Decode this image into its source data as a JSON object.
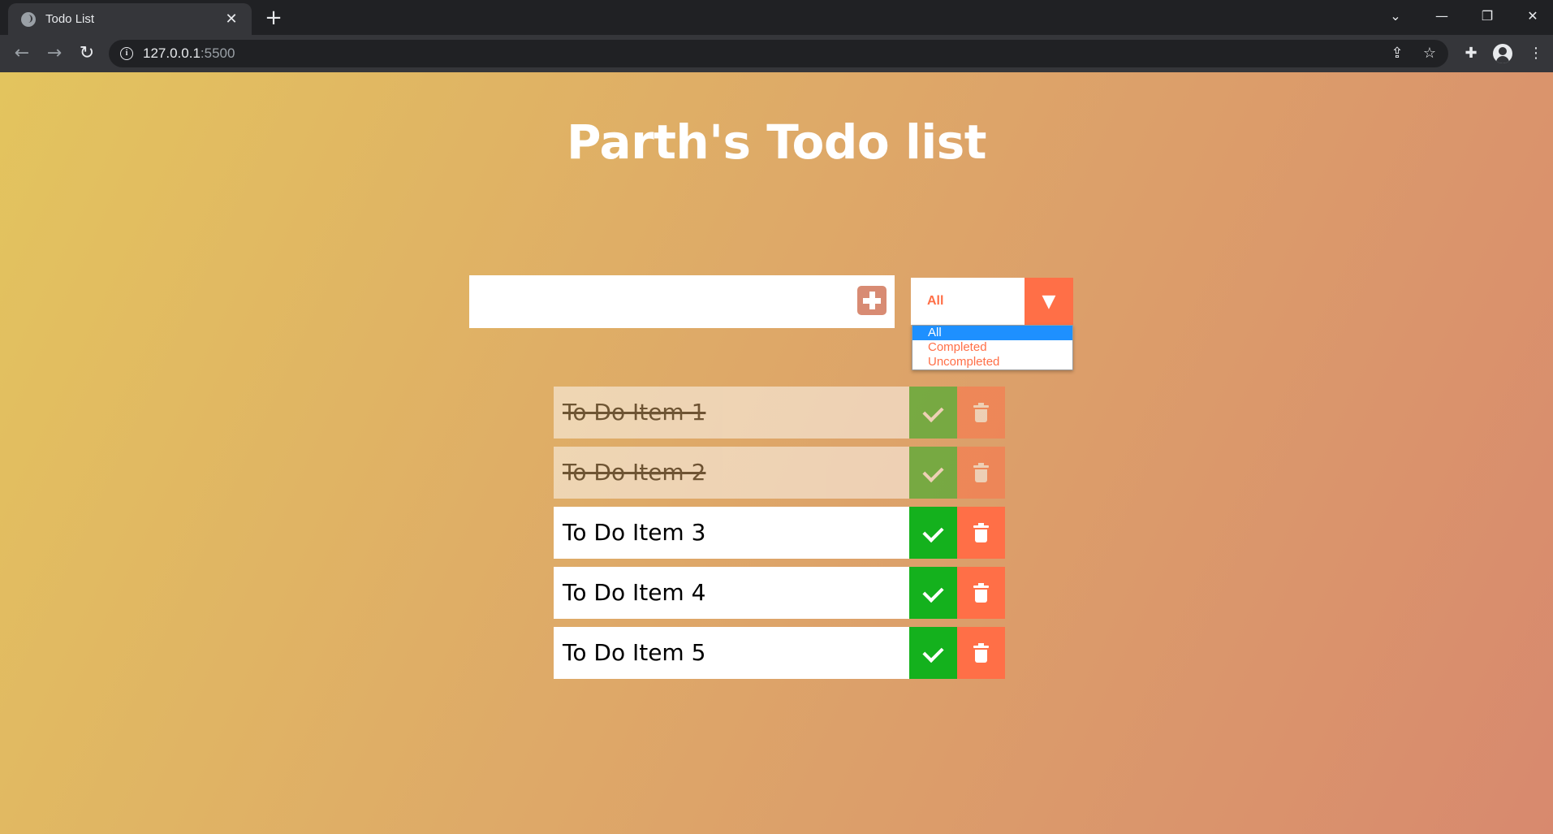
{
  "browser": {
    "tab_title": "Todo List",
    "tab_close": "✕",
    "new_tab": "+",
    "url_host": "127.0.0.1",
    "url_port": ":5500",
    "window_controls": {
      "tab_search": "⌄",
      "minimize": "—",
      "restore": "❐",
      "close": "✕"
    }
  },
  "page": {
    "title": "Parth's Todo list",
    "input": {
      "value": "",
      "placeholder": ""
    },
    "filter": {
      "selected": "All",
      "arrow": "▼",
      "options": [
        "All",
        "Completed",
        "Uncompleted"
      ]
    },
    "todos": [
      {
        "text": "To Do Item 1",
        "completed": true
      },
      {
        "text": "To Do Item 2",
        "completed": true
      },
      {
        "text": "To Do Item 3",
        "completed": false
      },
      {
        "text": "To Do Item 4",
        "completed": false
      },
      {
        "text": "To Do Item 5",
        "completed": false
      }
    ]
  },
  "colors": {
    "accent": "#ff6f47",
    "check": "#14b11d",
    "add_button": "#d88b73",
    "gradient_start": "#e3c45e",
    "gradient_end": "#d8896e",
    "selected_option": "#1e90ff"
  }
}
